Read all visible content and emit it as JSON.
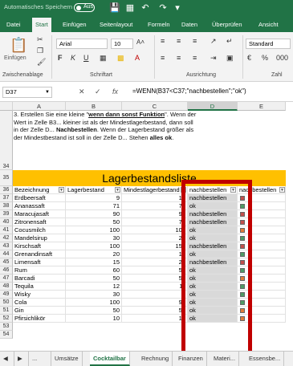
{
  "titlebar": {
    "autosave_label": "Automatisches Speichern",
    "toggle_label": "Aus",
    "icons": [
      "save-icon",
      "table-icon",
      "undo-icon",
      "redo-icon",
      "customize-icon"
    ]
  },
  "tabs": [
    "Datei",
    "Start",
    "Einfügen",
    "Seitenlayout",
    "Formeln",
    "Daten",
    "Überprüfen",
    "Ansicht"
  ],
  "ribbon": {
    "paste_label": "Einfügen",
    "font_name": "Arial",
    "font_size": "10",
    "number_format": "Standard",
    "groups": [
      "Zwischenablage",
      "Schriftart",
      "Ausrichtung",
      "Zahl"
    ]
  },
  "formula_bar": {
    "name_box": "D37",
    "fx": "fx",
    "formula": "=WENN(B37<C37;\"nachbestellen\";\"ok\")"
  },
  "columns": [
    "A",
    "B",
    "C",
    "D",
    "E"
  ],
  "note": {
    "row": "34",
    "line1": "3. Erstellen Sie eine kleine \"",
    "bold1": "wenn dann sonst Funktion",
    "line1b": "\". Wenn der Wert in Zelle B3... kleiner ist als der Mindestlagerbestand, dann soll in der Zelle D...",
    "bold2": "Nachbestellen",
    "line2": ". Wenn der Lagerbestand größer als der Mindestbestand ist soll in der Zelle D... Stehen ",
    "bold3": "alles ok",
    "line3": "."
  },
  "banner": {
    "row": "35",
    "title": "Lagerbestandsliste"
  },
  "header_row": {
    "row": "36",
    "cells": [
      "Bezeichnung",
      "Lagerbestand",
      "Mindestlagerbestand",
      "nachbestellen",
      "nachbestellen"
    ]
  },
  "rows": [
    {
      "n": "37",
      "name": "Erdbeersaft",
      "stock": "9",
      "min": "10",
      "status": "nachbestellen",
      "color": "#c0504d"
    },
    {
      "n": "38",
      "name": "Ananassaft",
      "stock": "71",
      "min": "70",
      "status": "ok",
      "color": "#4f9a65"
    },
    {
      "n": "39",
      "name": "Maracujasaft",
      "stock": "90",
      "min": "95",
      "status": "nachbestellen",
      "color": "#c0504d"
    },
    {
      "n": "40",
      "name": "Zitronensaft",
      "stock": "50",
      "min": "70",
      "status": "nachbestellen",
      "color": "#c0504d"
    },
    {
      "n": "41",
      "name": "Cocusmilch",
      "stock": "100",
      "min": "100",
      "status": "ok",
      "color": "#e07b39"
    },
    {
      "n": "42",
      "name": "Mandelsirup",
      "stock": "30",
      "min": "25",
      "status": "ok",
      "color": "#4f9a65"
    },
    {
      "n": "43",
      "name": "Kirschsaft",
      "stock": "100",
      "min": "150",
      "status": "nachbestellen",
      "color": "#c0504d"
    },
    {
      "n": "44",
      "name": "Grenandinsaft",
      "stock": "20",
      "min": "10",
      "status": "ok",
      "color": "#4f9a65"
    },
    {
      "n": "45",
      "name": "Limensaft",
      "stock": "15",
      "min": "20",
      "status": "nachbestellen",
      "color": "#c0504d"
    },
    {
      "n": "46",
      "name": "Rum",
      "stock": "60",
      "min": "50",
      "status": "ok",
      "color": "#4f9a65"
    },
    {
      "n": "47",
      "name": "Barcadi",
      "stock": "50",
      "min": "50",
      "status": "ok",
      "color": "#e07b39"
    },
    {
      "n": "48",
      "name": "Tequila",
      "stock": "12",
      "min": "11",
      "status": "ok",
      "color": "#4f9a65"
    },
    {
      "n": "49",
      "name": "Wisky",
      "stock": "30",
      "min": "5",
      "status": "ok",
      "color": "#4f9a65"
    },
    {
      "n": "50",
      "name": "Cola",
      "stock": "100",
      "min": "99",
      "status": "ok",
      "color": "#4f9a65"
    },
    {
      "n": "51",
      "name": "Gin",
      "stock": "50",
      "min": "50",
      "status": "ok",
      "color": "#e07b39"
    },
    {
      "n": "52",
      "name": "Pfirsichlikör",
      "stock": "10",
      "min": "10",
      "status": "ok",
      "color": "#e07b39"
    }
  ],
  "empty_rows": [
    "53",
    "54"
  ],
  "sheet_tabs": [
    "Umsätze",
    "Cocktailbar",
    "Rechnung",
    "Finanzen",
    "Materi...",
    "Essensbe..."
  ],
  "active_sheet": "Cocktailbar"
}
